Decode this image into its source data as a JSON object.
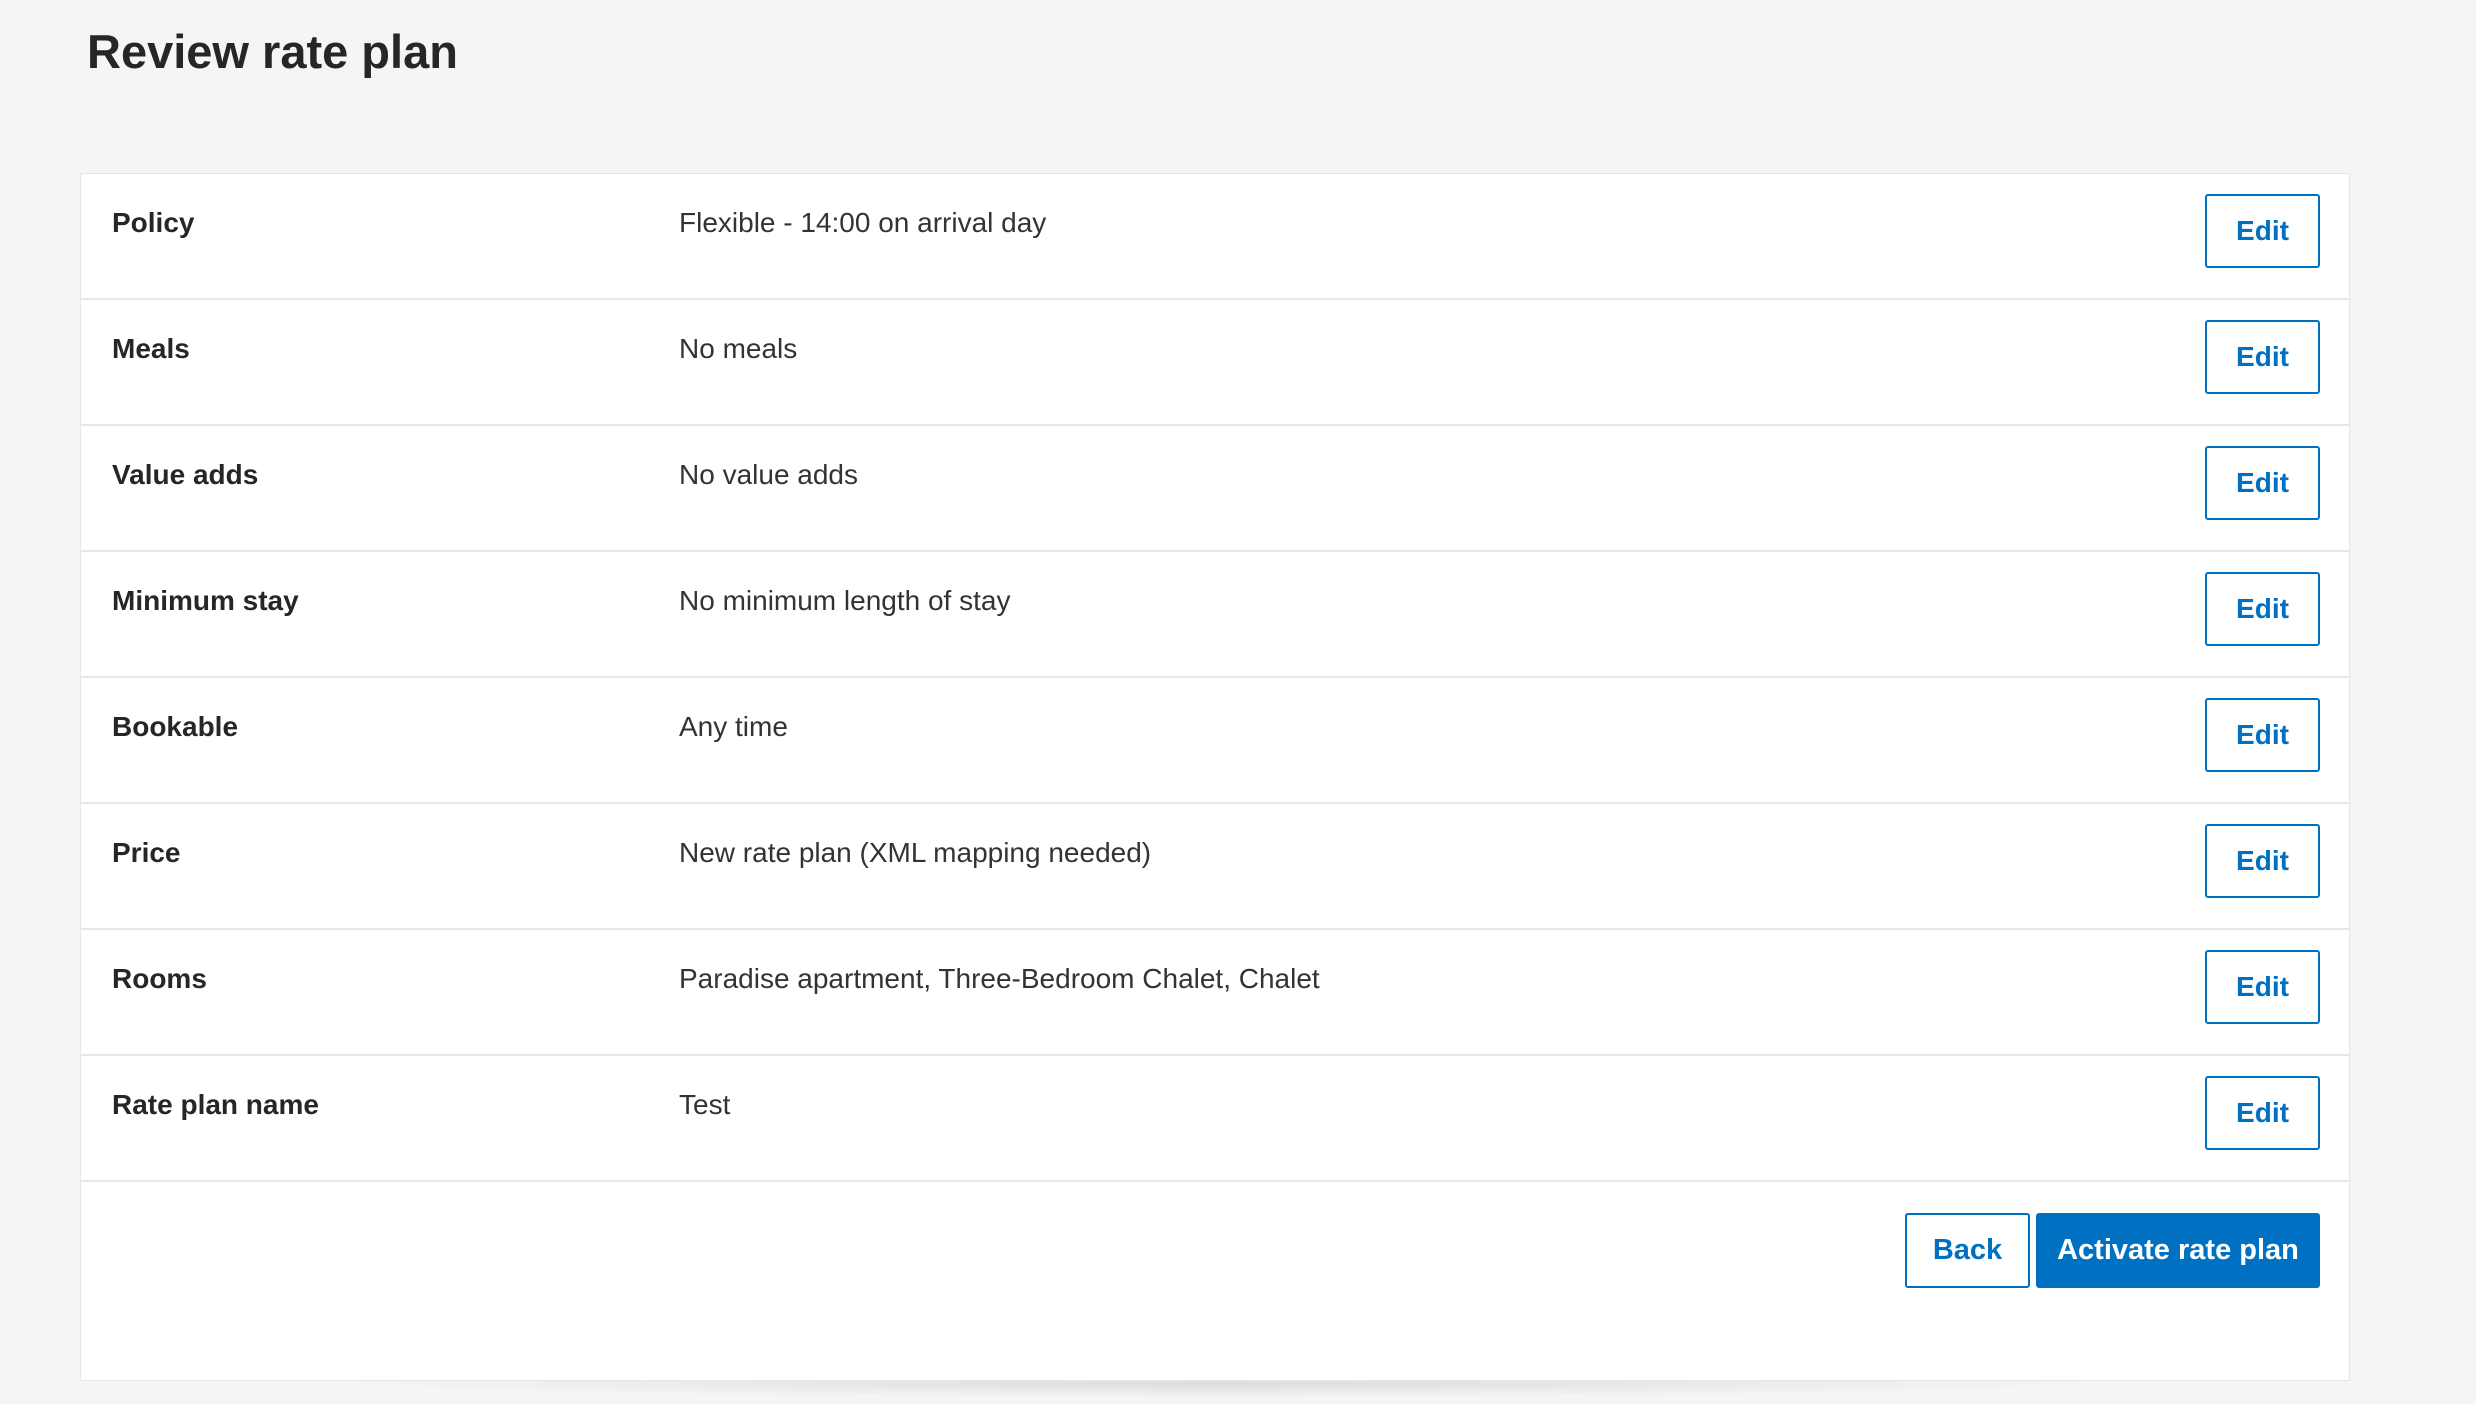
{
  "page": {
    "title": "Review rate plan"
  },
  "rows": [
    {
      "label": "Policy",
      "value": "Flexible - 14:00 on arrival day",
      "edit_label": "Edit"
    },
    {
      "label": "Meals",
      "value": "No meals",
      "edit_label": "Edit"
    },
    {
      "label": "Value adds",
      "value": "No value adds",
      "edit_label": "Edit"
    },
    {
      "label": "Minimum stay",
      "value": "No minimum length of stay",
      "edit_label": "Edit"
    },
    {
      "label": "Bookable",
      "value": "Any time",
      "edit_label": "Edit"
    },
    {
      "label": "Price",
      "value": "New rate plan (XML mapping needed)",
      "edit_label": "Edit"
    },
    {
      "label": "Rooms",
      "value": "Paradise apartment, Three-Bedroom Chalet, Chalet",
      "edit_label": "Edit"
    },
    {
      "label": "Rate plan name",
      "value": "Test",
      "edit_label": "Edit"
    }
  ],
  "actions": {
    "back_label": "Back",
    "activate_label": "Activate rate plan"
  },
  "colors": {
    "accent": "#0071c2",
    "page_background": "#f5f5f5",
    "card_background": "#ffffff",
    "divider": "#e7e7e7",
    "text": "#262626"
  }
}
